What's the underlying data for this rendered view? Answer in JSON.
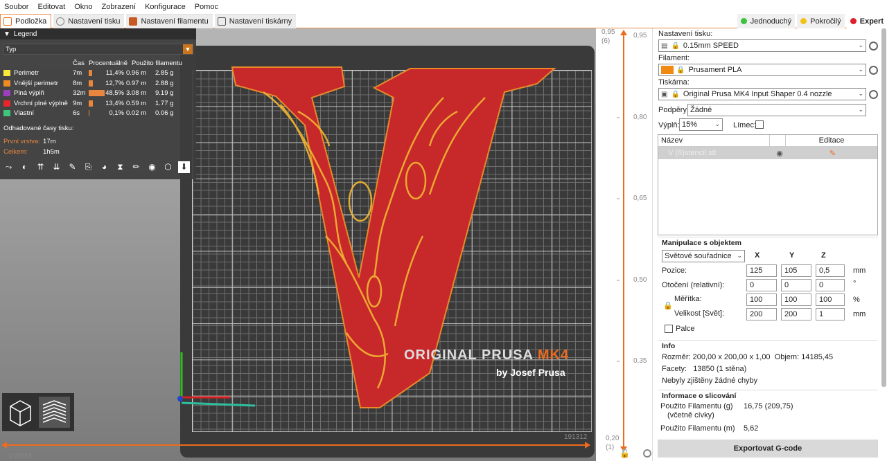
{
  "menu": [
    "Soubor",
    "Editovat",
    "Okno",
    "Zobrazení",
    "Konfigurace",
    "Pomoc"
  ],
  "tabs": [
    "Podložka",
    "Nastavení tisku",
    "Nastavení filamentu",
    "Nastavení tiskárny"
  ],
  "modes": [
    {
      "label": "Jednoduchý",
      "color": "#3cc13c"
    },
    {
      "label": "Pokročilý",
      "color": "#f2c21b"
    },
    {
      "label": "Expert",
      "color": "#e0202a"
    }
  ],
  "legend": {
    "title": "Legend",
    "type_label": "Typ",
    "headers": [
      "Čas",
      "Procentuálně",
      "Použito filamentu"
    ],
    "rows": [
      {
        "name": "Perimetr",
        "color": "#f7e93c",
        "time": "7m",
        "pct": "11,4%",
        "pct_value": 11.4,
        "len": "0.96 m",
        "wt": "2.85 g"
      },
      {
        "name": "Vnější perimetr",
        "color": "#f08a22",
        "time": "8m",
        "pct": "12,7%",
        "pct_value": 12.7,
        "len": "0.97 m",
        "wt": "2.88 g"
      },
      {
        "name": "Plná výplň",
        "color": "#9b3fbf",
        "time": "32m",
        "pct": "48,5%",
        "pct_value": 48.5,
        "len": "3.08 m",
        "wt": "9.19 g"
      },
      {
        "name": "Vrchní plné výplně",
        "color": "#e8262b",
        "time": "9m",
        "pct": "13,4%",
        "pct_value": 13.4,
        "len": "0.59 m",
        "wt": "1.77 g"
      },
      {
        "name": "Vlastní",
        "color": "#3ec77a",
        "time": "6s",
        "pct": "0,1%",
        "pct_value": 0.1,
        "len": "0.02 m",
        "wt": "0.06 g"
      }
    ],
    "estimated": "Odhadované časy tisku:",
    "first_layer_label": "První vrstva:",
    "first_layer": "17m",
    "total_label": "Celkem:",
    "total": "1h5m"
  },
  "bed": {
    "brand": "ORIGINAL PRUSA",
    "model": "MK4",
    "byline": "by Josef Prusa"
  },
  "hslider": {
    "left_value": "155034",
    "right_value": "191312"
  },
  "vslider": {
    "top": "0,95",
    "top_sub": "(6)",
    "ticks": [
      "0,95",
      "0,80",
      "0,65",
      "0,50",
      "0,35",
      "0,20"
    ],
    "bottom_sub": "(1)"
  },
  "panel": {
    "print_settings_label": "Nastavení tisku:",
    "print_settings": "0.15mm SPEED",
    "filament_label": "Filament:",
    "filament": "Prusament PLA",
    "filament_color": "#f08a12",
    "printer_label": "Tiskárna:",
    "printer": "Original Prusa MK4 Input Shaper 0.4 nozzle",
    "supports_label": "Podpěry:",
    "supports": "Žádné",
    "infill_label": "Výplň:",
    "infill": "15%",
    "brim_label": "Límec:",
    "objects_header_name": "Název",
    "objects_header_edit": "Editace",
    "object_name": "V (6)stencil.stl",
    "manip_title": "Manipulace s objektem",
    "coords": "Světové souřadnice",
    "axes": [
      "X",
      "Y",
      "Z"
    ],
    "position_label": "Pozice:",
    "position": [
      "125",
      "105",
      "0,5"
    ],
    "position_unit": "mm",
    "rotation_label": "Otočení (relativní):",
    "rotation": [
      "0",
      "0",
      "0"
    ],
    "rotation_unit": "°",
    "scale_label": "Měřítka:",
    "scale": [
      "100",
      "100",
      "100"
    ],
    "scale_unit": "%",
    "size_label": "Velikost [Svět]:",
    "size": [
      "200",
      "200",
      "1"
    ],
    "size_unit": "mm",
    "inches_label": "Palce",
    "info_title": "Info",
    "size_info_label": "Rozměr:",
    "size_info": "200,00 x 200,00 x 1,00",
    "volume_label": "Objem:",
    "volume": "14185,45",
    "facets_label": "Facety:",
    "facets": "13850 (1 stěna)",
    "errors": "Nebyly zjištěny žádné chyby",
    "slice_title": "Informace o slicování",
    "fil_g_label": "Použito Filamentu (g)",
    "fil_g_sub": "(včetně cívky)",
    "fil_g": "16,75 (209,75)",
    "fil_m_label": "Použito Filamentu (m)",
    "fil_m": "5,62",
    "export": "Exportovat G-code"
  }
}
